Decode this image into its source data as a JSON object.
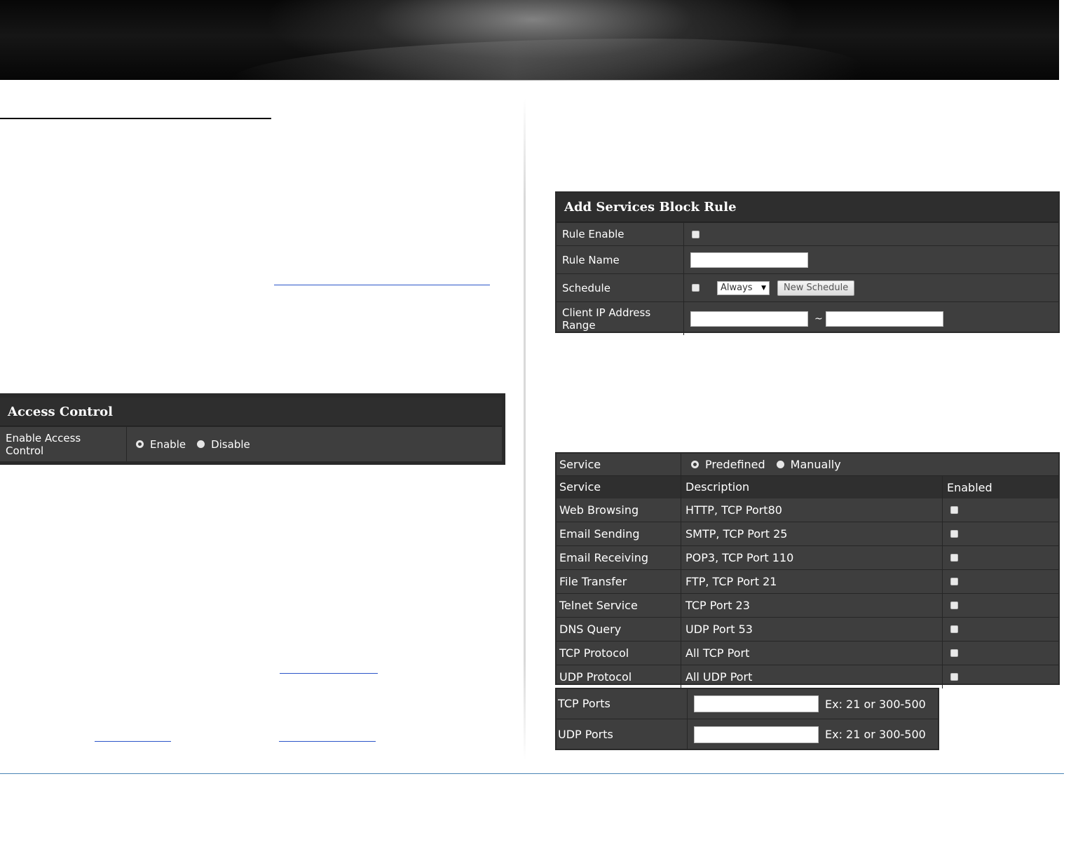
{
  "access_control": {
    "title": "Access Control",
    "enable_label": "Enable Access Control",
    "options": [
      "Enable",
      "Disable"
    ],
    "selected": "Enable"
  },
  "services_block_rule": {
    "title": "Add Services Block Rule",
    "rule_enable_label": "Rule Enable",
    "rule_enable_checked": false,
    "rule_name_label": "Rule Name",
    "rule_name_value": "",
    "schedule_label": "Schedule",
    "schedule_checked": false,
    "schedule_select_value": "Always",
    "new_schedule_button": "New Schedule",
    "client_ip_label": "Client IP Address Range",
    "client_ip_start": "",
    "range_separator": "~",
    "client_ip_end": ""
  },
  "service_table": {
    "service_label": "Service",
    "mode_options": [
      "Predefined",
      "Manually"
    ],
    "selected_mode": "Predefined",
    "columns": [
      "Service",
      "Description",
      "Enabled"
    ],
    "rows": [
      {
        "service": "Web Browsing",
        "description": "HTTP, TCP Port80",
        "enabled": false
      },
      {
        "service": "Email Sending",
        "description": "SMTP, TCP Port 25",
        "enabled": false
      },
      {
        "service": "Email Receiving",
        "description": "POP3, TCP Port 110",
        "enabled": false
      },
      {
        "service": "File Transfer",
        "description": "FTP, TCP Port 21",
        "enabled": false
      },
      {
        "service": "Telnet Service",
        "description": "TCP Port 23",
        "enabled": false
      },
      {
        "service": "DNS Query",
        "description": "UDP Port 53",
        "enabled": false
      },
      {
        "service": "TCP Protocol",
        "description": "All TCP Port",
        "enabled": false
      },
      {
        "service": "UDP Protocol",
        "description": "All UDP Port",
        "enabled": false
      }
    ]
  },
  "ports": {
    "tcp_label": "TCP Ports",
    "tcp_value": "",
    "tcp_hint": "Ex: 21 or 300-500",
    "udp_label": "UDP Ports",
    "udp_value": "",
    "udp_hint": "Ex: 21 or 300-500"
  }
}
